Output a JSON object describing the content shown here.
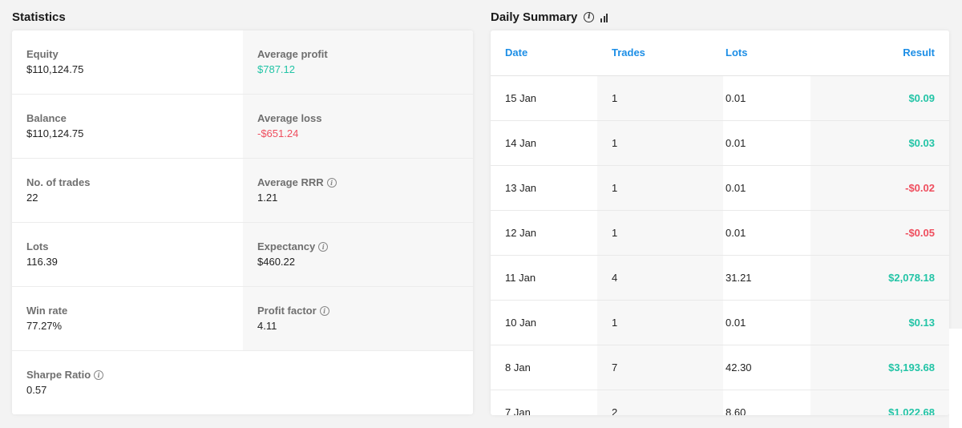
{
  "statistics": {
    "title": "Statistics",
    "rows": [
      {
        "left": {
          "label": "Equity",
          "value": "$110,124.75"
        },
        "right": {
          "label": "Average profit",
          "value": "$787.12",
          "tone": "pos"
        }
      },
      {
        "left": {
          "label": "Balance",
          "value": "$110,124.75"
        },
        "right": {
          "label": "Average loss",
          "value": "-$651.24",
          "tone": "neg"
        }
      },
      {
        "left": {
          "label": "No. of trades",
          "value": "22"
        },
        "right": {
          "label": "Average RRR",
          "value": "1.21",
          "info": true
        }
      },
      {
        "left": {
          "label": "Lots",
          "value": "116.39"
        },
        "right": {
          "label": "Expectancy",
          "value": "$460.22",
          "info": true
        }
      },
      {
        "left": {
          "label": "Win rate",
          "value": "77.27%"
        },
        "right": {
          "label": "Profit factor",
          "value": "4.11",
          "info": true
        }
      },
      {
        "left": {
          "label": "Sharpe Ratio",
          "value": "0.57",
          "info": true
        },
        "right": null
      }
    ]
  },
  "daily_summary": {
    "title": "Daily Summary",
    "icons": [
      "info-icon",
      "bar-chart-icon"
    ],
    "columns": {
      "date": "Date",
      "trades": "Trades",
      "lots": "Lots",
      "result": "Result"
    },
    "rows": [
      {
        "date": "15 Jan",
        "trades": "1",
        "lots": "0.01",
        "result": "$0.09",
        "tone": "pos"
      },
      {
        "date": "14 Jan",
        "trades": "1",
        "lots": "0.01",
        "result": "$0.03",
        "tone": "pos"
      },
      {
        "date": "13 Jan",
        "trades": "1",
        "lots": "0.01",
        "result": "-$0.02",
        "tone": "neg"
      },
      {
        "date": "12 Jan",
        "trades": "1",
        "lots": "0.01",
        "result": "-$0.05",
        "tone": "neg"
      },
      {
        "date": "11 Jan",
        "trades": "4",
        "lots": "31.21",
        "result": "$2,078.18",
        "tone": "pos"
      },
      {
        "date": "10 Jan",
        "trades": "1",
        "lots": "0.01",
        "result": "$0.13",
        "tone": "pos"
      },
      {
        "date": "8 Jan",
        "trades": "7",
        "lots": "42.30",
        "result": "$3,193.68",
        "tone": "pos"
      },
      {
        "date": "7 Jan",
        "trades": "2",
        "lots": "8.60",
        "result": "$1,022.68",
        "tone": "pos"
      }
    ]
  },
  "colors": {
    "positive": "#22c4a6",
    "negative": "#ef4e5e",
    "header_blue": "#1c8ee6"
  }
}
